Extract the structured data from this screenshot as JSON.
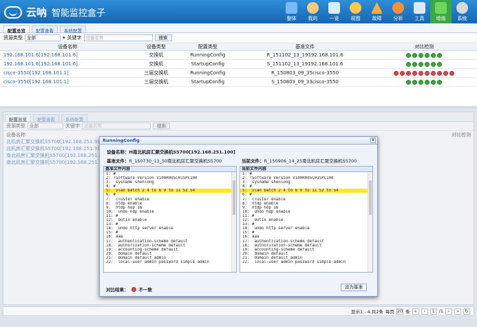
{
  "app": {
    "name": "云呐",
    "subtitle": "智能监控盒子"
  },
  "nav": [
    {
      "label": "整体",
      "color": "#7ab8ff"
    },
    {
      "label": "我的",
      "color": "#f7c97d"
    },
    {
      "label": "一览",
      "color": "#d8ecff"
    },
    {
      "label": "视图",
      "color": "#ffc84a"
    },
    {
      "label": "故障",
      "color": "#ffae34"
    },
    {
      "label": "分析",
      "color": "#ff8f39"
    },
    {
      "label": "工具",
      "color": "#dce8f6"
    },
    {
      "label": "增值",
      "color": "#6ed85c"
    },
    {
      "label": "系统",
      "color": "#d9d9d9"
    }
  ],
  "tabs": [
    "配置总览",
    "配置查看",
    "系统配置"
  ],
  "filter": {
    "type_label": "资源类型",
    "type_value": "全部",
    "keyword_label": "关键字",
    "placeholder": "设备名称",
    "search": "搜索"
  },
  "top_table": {
    "headers": [
      "设备名称",
      "设备类型",
      "配置类型",
      "基准文件",
      "对比检测"
    ],
    "rows": [
      {
        "name": "192.168.101.6[192.168.101.6]",
        "type": "交换机",
        "config": "RunningConfig",
        "base": "R_151102_13_19192.168.101.6",
        "status": "green"
      },
      {
        "name": "192.168.101.6[192.168.101.6]",
        "type": "交换机",
        "config": "StartupConfig",
        "base": "S_151102_13_19192.168.101.6",
        "status": "green"
      },
      {
        "name": "cisco-3550[192.168.101.1]",
        "type": "三层交换机",
        "config": "RunningConfig",
        "base": "R_150803_09_35cisco-3550",
        "status": "red"
      },
      {
        "name": "cisco-3550[192.168.101.1]",
        "type": "三层交换机",
        "config": "StartupConfig",
        "base": "S_150803_09_33cisco-3550",
        "status": "green"
      }
    ]
  },
  "back_table": {
    "header": [
      "设备名称",
      "对比检测"
    ],
    "rows": [
      "北机房汇聚交换机S5700[192.168.251.99]",
      "北机房汇聚交换机S5700[192.168.251.99]",
      "南北机房汇聚交换机S5700[192.168.251.100]",
      "南北机房汇聚交换机S5700[192.168.251.100]"
    ]
  },
  "modal": {
    "title": "RunningConfig",
    "device_label": "设备名称：",
    "device_value": "H南北机房汇聚交换机S5700[192.168.251.100]",
    "base_label": "基准文件：",
    "base_value": "R_150730_13_50南北机房汇聚交换机S5700",
    "current_label": "当前文件：",
    "current_value": "R_150906_14_25南北机房汇聚交换机S5700",
    "left_header": "基准文件内容",
    "right_header": "当前文件内容",
    "left_lines": [
      "1: #",
      "2: !Software Version V100R005C01SPC100",
      "3:  sysname shenlong",
      "4: #",
      "5:  vlan batch 2 4 to 6 9 to 11 52 54",
      "6: #",
      "7:  cluster enable",
      "8:  ntdp enable",
      "9:  ntdp hop 16",
      "10:  undo ndp enable",
      "11: #",
      "12:  dot1x enable",
      "13: #",
      "14:  undo http server enable",
      "15: #",
      "16: aaa",
      "17:  authentication-scheme default",
      "18:  authorization-scheme default",
      "19:  accounting-scheme default",
      "20:  domain default",
      "21:  domain default_admin",
      "22:  local-user admin password simple admin"
    ],
    "right_lines": [
      "1: #",
      "2: !Software Version V100R005C01SPC100",
      "3:  sysname shenlong",
      "4: #",
      "5:  vlan batch 2 4 to 6 9 to 11 52 to 54",
      "6: #",
      "7:  cluster enable",
      "8:  ntdp enable",
      "9:  ntdp hop 16",
      "10:  undo ndp enable",
      "11: #",
      "12:  dot1x enable",
      "13: #",
      "14:  undo http server enable",
      "15: #",
      "16: aaa",
      "17:  authentication-scheme default",
      "18:  authorization-scheme default",
      "19:  accounting-scheme default",
      "20:  domain default",
      "21:  domain default_admin",
      "22:  local-user admin password simple admin"
    ],
    "result_label": "对比结果：",
    "result_value": "不一致",
    "set_button": "设为基准"
  },
  "footer": {
    "records": "显示1 - 4,共2条",
    "per_page": "每页",
    "page_size": "20",
    "unit": "条",
    "page": "1",
    "total": "/1"
  }
}
